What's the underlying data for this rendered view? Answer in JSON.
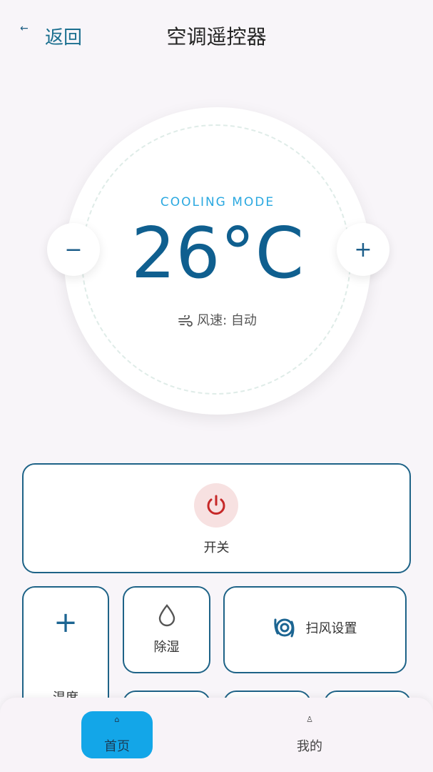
{
  "header": {
    "back_icon": "←",
    "back_label": "返回",
    "title": "空调遥控器"
  },
  "dial": {
    "mode": "COOLING MODE",
    "temperature": "26°C",
    "fan_label": "风速: 自动",
    "minus_label": "−",
    "plus_label": "+"
  },
  "controls": {
    "power_label": "开关",
    "temp_up_symbol": "+",
    "temp_up_label": "温度",
    "dehumidify_label": "除湿",
    "swing_label": "扫风设置"
  },
  "nav": {
    "home_icon": "⌂",
    "home_label": "首页",
    "me_icon": "♙",
    "me_label": "我的"
  },
  "colors": {
    "accent": "#13a6e8",
    "primary_dark": "#1e6387",
    "power_red": "#c62828"
  }
}
